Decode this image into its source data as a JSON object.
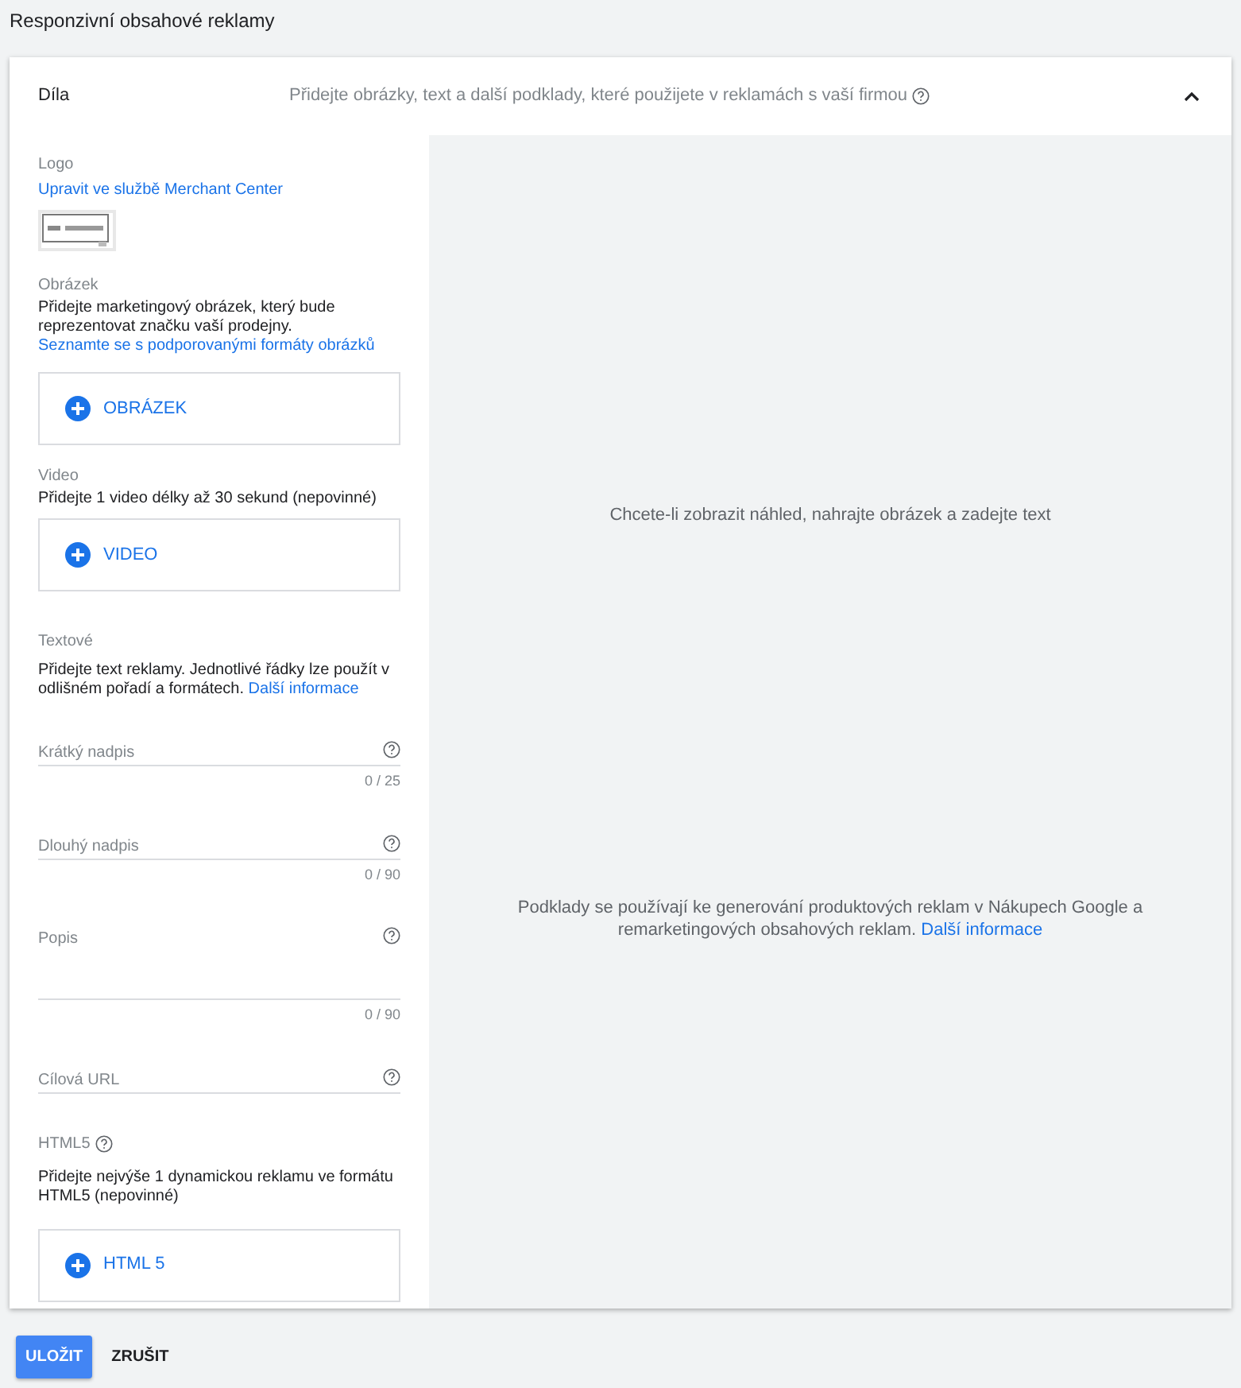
{
  "page_title": "Responzivní obsahové reklamy",
  "panel": {
    "title": "Díla",
    "subtitle": "Přidejte obrázky, text a další podklady, které použijete v reklamách s vaší firmou",
    "expanded": true
  },
  "logo": {
    "label": "Logo",
    "link": "Upravit ve službě Merchant Center"
  },
  "image_section": {
    "label": "Obrázek",
    "description": "Přidejte marketingový obrázek, který bude reprezentovat značku vaší prodejny.",
    "link": "Seznamte se s podporovanými formáty obrázků",
    "button": "OBRÁZEK"
  },
  "video_section": {
    "label": "Video",
    "description": "Přidejte 1 video délky až 30 sekund (nepovinné)",
    "button": "VIDEO"
  },
  "text_section": {
    "label": "Textové",
    "description": "Přidejte text reklamy. Jednotlivé řádky lze použít v odlišném pořadí a formátech.",
    "link": "Další informace"
  },
  "fields": [
    {
      "kind": "input",
      "placeholder": "Krátký nadpis",
      "counter": "0 / 25"
    },
    {
      "kind": "input",
      "placeholder": "Dlouhý nadpis",
      "counter": "0 / 90"
    },
    {
      "kind": "textarea",
      "placeholder": "Popis",
      "counter": "0 / 90"
    },
    {
      "kind": "input",
      "placeholder": "Cílová URL"
    }
  ],
  "html5_section": {
    "label": "HTML5",
    "description": "Přidejte nejvýše 1 dynamickou reklamu ve formátu HTML5 (nepovinné)",
    "button": "HTML 5"
  },
  "preview": {
    "empty_message": "Chcete-li zobrazit náhled, nahrajte obrázek a zadejte text",
    "note": "Podklady se používají ke generování produktových reklam v Nákupech Google a remarketingových obsahových reklam.",
    "link": "Další informace"
  },
  "actions": {
    "save": "ULOŽIT",
    "cancel": "ZRUŠIT"
  }
}
